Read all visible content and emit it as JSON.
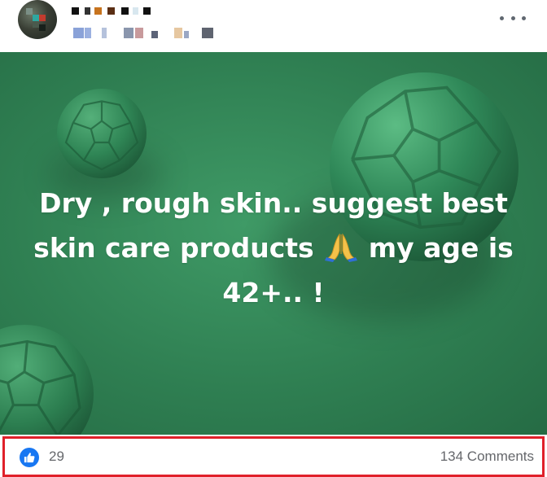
{
  "post": {
    "author_name": "",
    "meta": "",
    "text_line1": "Dry , rough skin.. suggest best",
    "text_line2_a": "skin care products",
    "text_line2_b": "my age is",
    "text_line3": "42+.. !",
    "emoji": "folded-hands",
    "background_color": "#2f7f52"
  },
  "reactions": {
    "like_count": "29",
    "comments_label": "134 Comments",
    "like_color": "#1877f2"
  },
  "highlight_color": "#e0202a"
}
